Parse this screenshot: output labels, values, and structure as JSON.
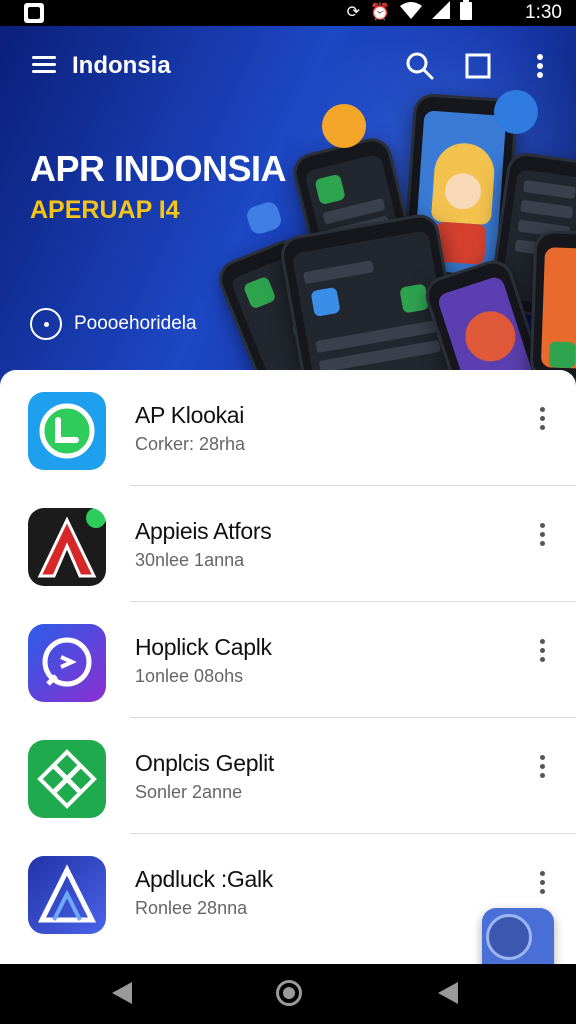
{
  "status_bar": {
    "time": "1:30",
    "icons": [
      "app-notification-icon",
      "sync-icon",
      "alarm-icon",
      "wifi-icon",
      "signal-icon",
      "battery-icon"
    ]
  },
  "header": {
    "title": "Indonsia",
    "icons": [
      "menu-icon",
      "search-icon",
      "square-icon",
      "more-vert-icon"
    ]
  },
  "hero": {
    "title": "APR INDONSIA",
    "subtitle": "APERUAP I4",
    "link_label": "Poooehoridela",
    "colors": {
      "title": "#ffffff",
      "subtitle": "#f5c518",
      "background": "#1d47c4"
    }
  },
  "apps": [
    {
      "name": "AP Klookai",
      "meta": "Corker: 28rha",
      "icon": "green-chat-icon",
      "color": "#2196f3"
    },
    {
      "name": "Appieis Atfors",
      "meta": "30nlee 1anna",
      "icon": "red-a-icon",
      "color": "#d62828"
    },
    {
      "name": "Hoplick Caplk",
      "meta": "1onlee 08ohs",
      "icon": "messenger-icon",
      "color": "#7b3fe4"
    },
    {
      "name": "Onplcis Geplit",
      "meta": "Sonler 2anne",
      "icon": "green-x-icon",
      "color": "#1faa4d"
    },
    {
      "name": "Apdluck :Galk",
      "meta": "Ronlee 28nna",
      "icon": "blue-a-icon",
      "color": "#3a4fd8"
    }
  ],
  "fab": {
    "icon": "compass-icon"
  },
  "nav": {
    "icons": [
      "back-icon",
      "home-icon",
      "recent-icon"
    ]
  }
}
